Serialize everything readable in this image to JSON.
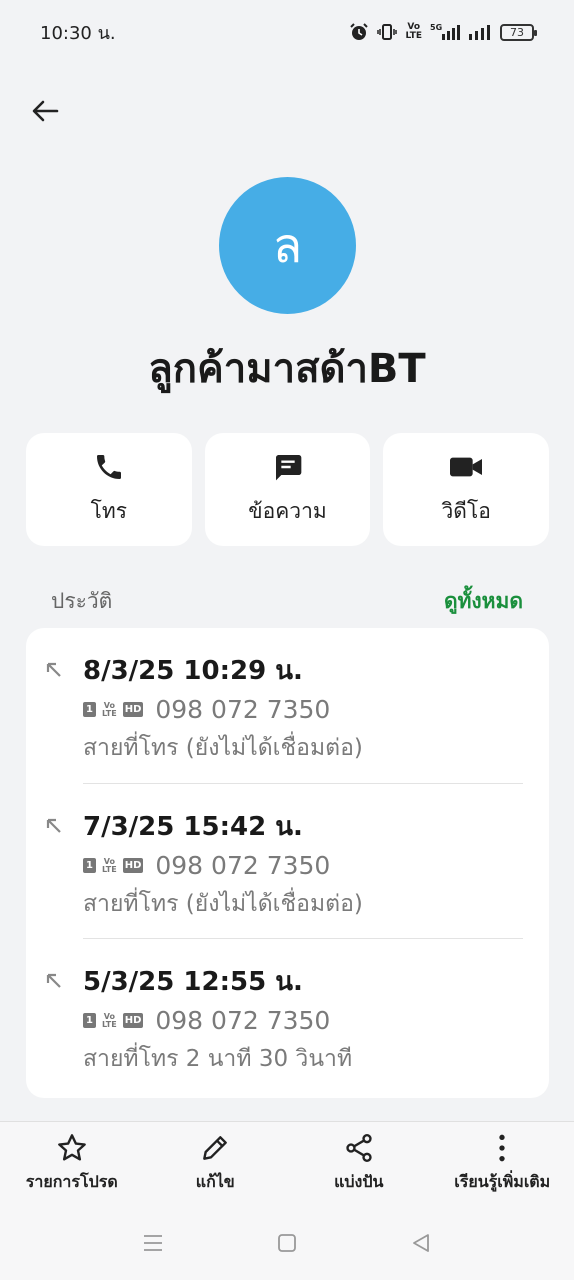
{
  "status_bar": {
    "time": "10:30 น.",
    "battery": "73",
    "network_5g": "5G",
    "volte": "VoLTE"
  },
  "contact": {
    "avatar_letter": "ล",
    "name": "ลูกค้ามาสด้าBT",
    "avatar_color": "#46ade6"
  },
  "actions": [
    {
      "label": "โทร",
      "icon": "phone-icon"
    },
    {
      "label": "ข้อความ",
      "icon": "message-icon"
    },
    {
      "label": "วิดีโอ",
      "icon": "video-icon"
    }
  ],
  "history": {
    "title": "ประวัติ",
    "see_all": "ดูทั้งหมด",
    "entries": [
      {
        "datetime": "8/3/25 10:29 น.",
        "number": "098 072 7350",
        "status": "สายที่โทร (ยังไม่ได้เชื่อมต่อ)",
        "sim": "1",
        "hd": "HD"
      },
      {
        "datetime": "7/3/25 15:42 น.",
        "number": "098 072 7350",
        "status": "สายที่โทร (ยังไม่ได้เชื่อมต่อ)",
        "sim": "1",
        "hd": "HD"
      },
      {
        "datetime": "5/3/25 12:55 น.",
        "number": "098 072 7350",
        "status": "สายที่โทร  2 นาที 30 วินาที",
        "sim": "1",
        "hd": "HD"
      }
    ]
  },
  "bottom_bar": [
    {
      "label": "รายการโปรด",
      "icon": "star-icon"
    },
    {
      "label": "แก้ไข",
      "icon": "pencil-icon"
    },
    {
      "label": "แบ่งปัน",
      "icon": "share-icon"
    },
    {
      "label": "เรียนรู้เพิ่มเติม",
      "icon": "more-vert-icon"
    }
  ],
  "colors": {
    "accent_green": "#1a8f3c",
    "background": "#f2f3f5"
  }
}
